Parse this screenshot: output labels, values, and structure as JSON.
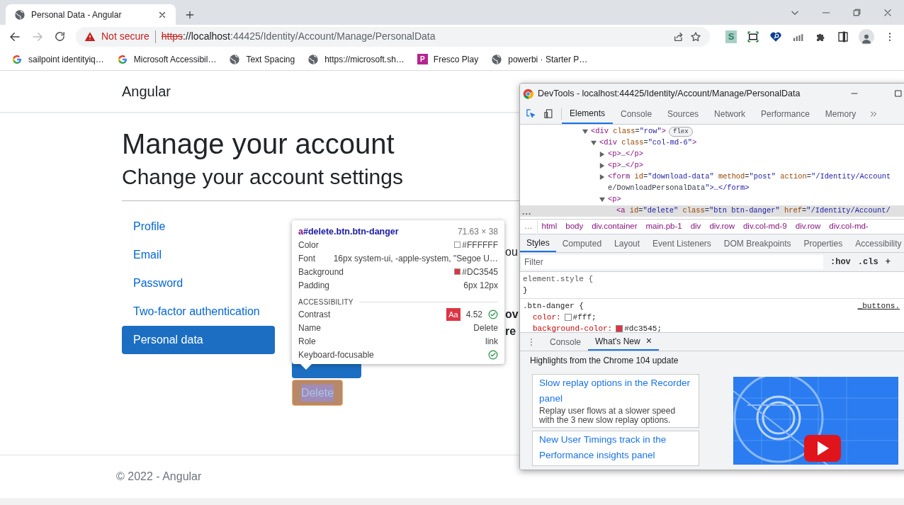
{
  "browser": {
    "tab": {
      "title": "Personal Data - Angular"
    },
    "address": {
      "warning": "Not secure",
      "scheme": "https",
      "host": "://localhost",
      "rest": ":44425/Identity/Account/Manage/PersonalData"
    },
    "extension_badge": "S",
    "bookmarks": [
      {
        "label": "sailpoint identityiq…",
        "kind": "google"
      },
      {
        "label": "Microsoft Accessibil…",
        "kind": "google"
      },
      {
        "label": "Text Spacing",
        "kind": "globe"
      },
      {
        "label": "https://microsoft.sh…",
        "kind": "globe"
      },
      {
        "label": "Fresco Play",
        "kind": "letter",
        "letter": "P"
      },
      {
        "label": "powerbi  · Starter P…",
        "kind": "globe"
      }
    ]
  },
  "page": {
    "brand": "Angular",
    "title": "Manage your account",
    "subtitle": "Change your account settings",
    "nav": [
      {
        "label": "Profile",
        "selected": false
      },
      {
        "label": "Email",
        "selected": false
      },
      {
        "label": "Password",
        "selected": false
      },
      {
        "label": "Two-factor authentication",
        "selected": false
      },
      {
        "label": "Personal data",
        "selected": true
      }
    ],
    "fragments": [
      {
        "text": "ou",
        "bold": false
      },
      {
        "text": "ov",
        "bold": true
      },
      {
        "text": "re",
        "bold": true
      }
    ],
    "delete_button": {
      "label": "Delete",
      "inspected": true
    },
    "footer": "© 2022 - Angular"
  },
  "tooltip": {
    "tag": "a",
    "selector": "#delete.btn.btn-danger",
    "size": "71.63 × 38",
    "props": [
      {
        "label": "Color",
        "value": "#FFFFFF",
        "color": "#ffffff"
      },
      {
        "label": "Font",
        "value": "16px system-ui, -apple-system, \"Segoe U…"
      },
      {
        "label": "Background",
        "value": "#DC3545",
        "color": "#dc3545"
      },
      {
        "label": "Padding",
        "value": "6px 12px"
      }
    ],
    "section": "ACCESSIBILITY",
    "a11y": [
      {
        "label": "Contrast",
        "kind": "contrast",
        "badge": "Aa",
        "value": "4.52",
        "pass": true
      },
      {
        "label": "Name",
        "kind": "text",
        "value": "Delete"
      },
      {
        "label": "Role",
        "kind": "text",
        "value": "link"
      },
      {
        "label": "Keyboard-focusable",
        "kind": "check",
        "pass": true
      }
    ]
  },
  "devtools": {
    "title": "DevTools - localhost:44425/Identity/Account/Manage/PersonalData",
    "tabs": [
      {
        "label": "Elements",
        "selected": true
      },
      {
        "label": "Console",
        "selected": false
      },
      {
        "label": "Sources",
        "selected": false
      },
      {
        "label": "Network",
        "selected": false
      },
      {
        "label": "Performance",
        "selected": false
      },
      {
        "label": "Memory",
        "selected": false
      }
    ],
    "dom": [
      {
        "text": "<div class=\"row\">",
        "badge": "flex",
        "expanded": true,
        "children": [
          {
            "text": "<div class=\"col-md-6\">",
            "expanded": true,
            "children": [
              {
                "text": "<p>…</p>",
                "expanded": false
              },
              {
                "text": "<p>…</p>",
                "expanded": false
              },
              {
                "text": "<form id=\"download-data\" method=\"post\" action=\"/Identity/Account",
                "wrap": "e/DownloadPersonalData\">…</form>",
                "expanded": false
              },
              {
                "text": "<p>",
                "expanded": true,
                "children": [
                  {
                    "text": "<a id=\"delete\" class=\"btn btn-danger\" href=\"/Identity/Account/",
                    "selected": true
                  }
                ]
              }
            ]
          }
        ]
      }
    ],
    "breadcrumbs": [
      "…",
      "html",
      "body",
      "div.container",
      "main.pb-1",
      "div",
      "div.row",
      "div.col-md-9",
      "div.row",
      "div.col-md-"
    ],
    "style_tabs": [
      {
        "label": "Styles",
        "selected": true
      },
      {
        "label": "Computed",
        "selected": false
      },
      {
        "label": "Layout",
        "selected": false
      },
      {
        "label": "Event Listeners",
        "selected": false
      },
      {
        "label": "DOM Breakpoints",
        "selected": false
      },
      {
        "label": "Properties",
        "selected": false
      },
      {
        "label": "Accessibility",
        "selected": false
      }
    ],
    "filter": {
      "placeholder": "Filter",
      "buttons": [
        ":hov",
        ".cls",
        "+"
      ]
    },
    "rules": [
      {
        "open": "element.style {",
        "close": "}"
      },
      {
        "open": ".btn-danger {",
        "source": "_buttons.",
        "declarations": [
          {
            "prop": "color:",
            "value": "#fff;",
            "color": "#ffffff"
          },
          {
            "prop": "background-color:",
            "value": "#dc3545;",
            "color": "#dc3545"
          }
        ]
      }
    ],
    "drawer_tabs": [
      {
        "label": "Console",
        "selected": false,
        "closable": false
      },
      {
        "label": "What's New",
        "selected": true,
        "closable": true
      }
    ],
    "close_mark": "×",
    "whats_new": {
      "heading": "Highlights from the Chrome 104 update",
      "cards": [
        {
          "title": "Slow replay options in the Recorder panel",
          "body": "Replay user flows at a slower speed with the 3 new slow replay options."
        },
        {
          "title": "New User Timings track in the Performance insights panel"
        }
      ]
    }
  }
}
